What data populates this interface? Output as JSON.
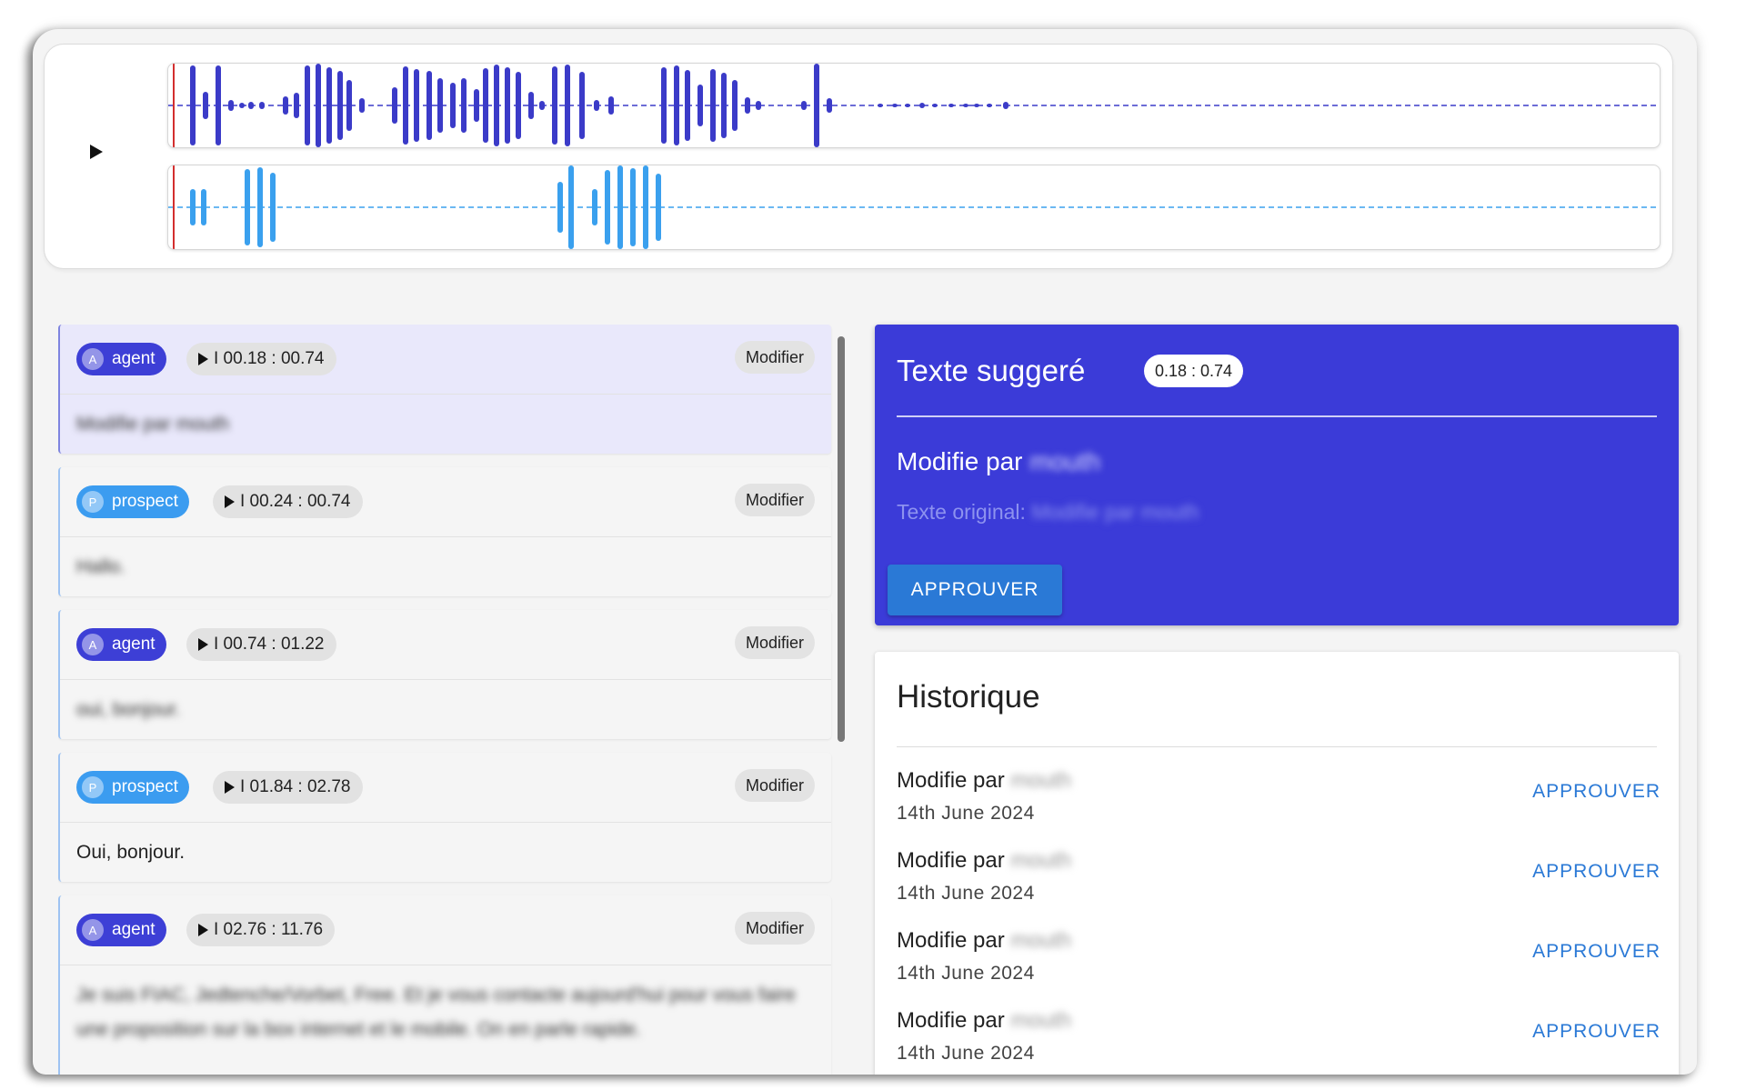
{
  "colors": {
    "accent_indigo": "#3b3bd8",
    "agent_wave": "#3b3bc8",
    "prospect_wave": "#3aa0ee",
    "agent_chip": "#3d3fd6",
    "prospect_chip": "#3b9cf0",
    "approve_blue": "#2a79d6"
  },
  "player": {
    "play_icon": "play-icon"
  },
  "segments": [
    {
      "role": "agent",
      "avatar": "A",
      "time": "I 00.18 : 00.74",
      "modify": "Modifier",
      "text": "Modifie par mouth",
      "active": true
    },
    {
      "role": "prospect",
      "avatar": "P",
      "time": "I 00.24 : 00.74",
      "modify": "Modifier",
      "text": "Hallo.",
      "active": false
    },
    {
      "role": "agent",
      "avatar": "A",
      "time": "I 00.74 : 01.22",
      "modify": "Modifier",
      "text": "oui, bonjour.",
      "active": false
    },
    {
      "role": "prospect",
      "avatar": "P",
      "time": "I 01.84 : 02.78",
      "modify": "Modifier",
      "text": "Oui, bonjour.",
      "active": false
    },
    {
      "role": "agent",
      "avatar": "A",
      "time": "I 02.76 : 11.76",
      "modify": "Modifier",
      "text": "Je suis FIAC, Jedtenche/Vorbet, Free. Et je vous contacte aujourd'hui pour vous faire une proposition sur la box internet et le mobile. On en parle rapide.",
      "active": false
    }
  ],
  "suggestion": {
    "title": "Texte suggeré",
    "range": "0.18 : 0.74",
    "modified_by_label": "Modifie par",
    "modified_by_name": "mouth",
    "original_label": "Texte original:",
    "original_text": "Modifie par mouth",
    "approve": "APPROUVER"
  },
  "history": {
    "title": "Historique",
    "items": [
      {
        "label": "Modifie par",
        "name": "mouth",
        "date": "14th June 2024",
        "action": "APPROUVER"
      },
      {
        "label": "Modifie par",
        "name": "mouth",
        "date": "14th June 2024",
        "action": "APPROUVER"
      },
      {
        "label": "Modifie par",
        "name": "mouth",
        "date": "14th June 2024",
        "action": "APPROUVER"
      },
      {
        "label": "Modifie par",
        "name": "mouth",
        "date": "14th June 2024",
        "action": "APPROUVER"
      }
    ]
  }
}
